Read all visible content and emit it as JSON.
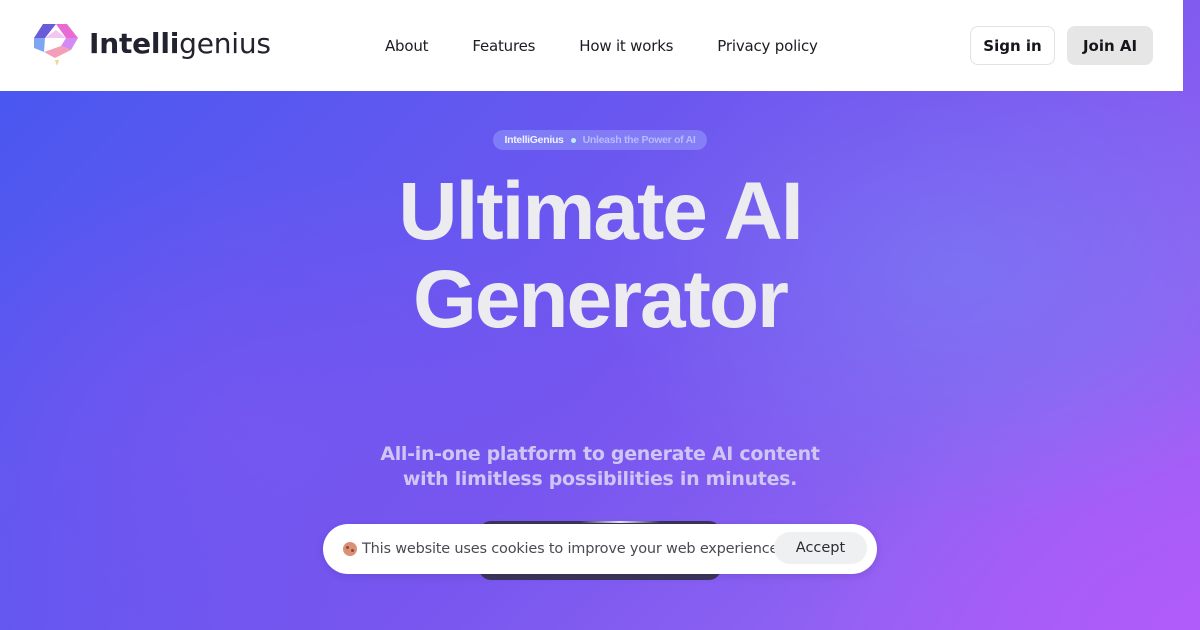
{
  "brand": {
    "name_bold": "Intelli",
    "name_light": "genius",
    "logo_icon": "hexagon-play-logo-icon"
  },
  "nav": {
    "items": [
      {
        "label": "About"
      },
      {
        "label": "Features"
      },
      {
        "label": "How it works"
      },
      {
        "label": "Privacy policy"
      }
    ]
  },
  "header_actions": {
    "sign_in": "Sign in",
    "join": "Join AI"
  },
  "hero": {
    "badge_brand": "IntelliGenius",
    "badge_tag": "Unleash the Power of AI",
    "title_line1": "Ultimate AI",
    "title_line2": "Generator",
    "subtitle_line1": "All-in-one platform to generate AI content",
    "subtitle_line2": "with limitless possibilities in minutes."
  },
  "cookie_banner": {
    "icon": "cookie-icon",
    "message": "This website uses cookies to improve your web experience.",
    "accept_label": "Accept"
  },
  "colors": {
    "gradient_start": "#4557f0",
    "gradient_mid": "#7656ef",
    "gradient_end": "#a95cf7",
    "title_text": "#ebebf0",
    "subtitle_text": "#cfc6f6"
  }
}
